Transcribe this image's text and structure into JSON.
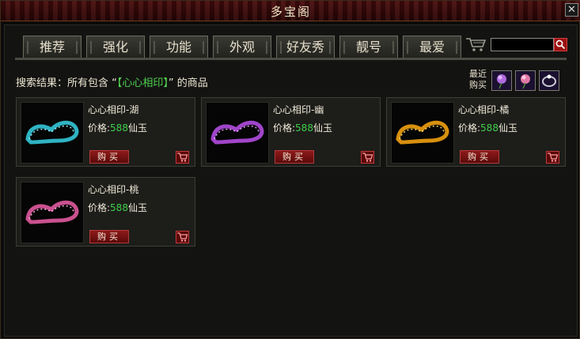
{
  "window": {
    "title": "多宝阁",
    "close_label": "✕"
  },
  "tabs": [
    {
      "label": "推荐"
    },
    {
      "label": "强化"
    },
    {
      "label": "功能"
    },
    {
      "label": "外观"
    },
    {
      "label": "好友秀"
    },
    {
      "label": "靓号"
    },
    {
      "label": "最爱"
    }
  ],
  "search": {
    "value": "",
    "placeholder": ""
  },
  "result": {
    "prefix": "搜索结果：所有包含 “",
    "keyword": "【心心相印】",
    "suffix": "” 的商品"
  },
  "recent": {
    "label_line1": "最近",
    "label_line2": "购买",
    "items": [
      {
        "icon": "purple-rose-icon",
        "color": "#b26be0"
      },
      {
        "icon": "pink-rose-icon",
        "color": "#e07aa6"
      },
      {
        "icon": "silver-ring-icon",
        "color": "#c9c9d4"
      }
    ]
  },
  "products": [
    {
      "name": "心心相印-湖",
      "price_label": "价格:",
      "price": "588",
      "currency": "仙玉",
      "buy_label": "购买",
      "color": "#34c6d8",
      "glow": "#8ff0ff"
    },
    {
      "name": "心心相印-幽",
      "price_label": "价格:",
      "price": "588",
      "currency": "仙玉",
      "buy_label": "购买",
      "color": "#b24ce0",
      "glow": "#e6a2ff"
    },
    {
      "name": "心心相印-橘",
      "price_label": "价格:",
      "price": "588",
      "currency": "仙玉",
      "buy_label": "购买",
      "color": "#f0a010",
      "glow": "#ffd86a"
    },
    {
      "name": "心心相印-桃",
      "price_label": "价格:",
      "price": "588",
      "currency": "仙玉",
      "buy_label": "购买",
      "color": "#e05a9e",
      "glow": "#ffb0d8"
    }
  ]
}
